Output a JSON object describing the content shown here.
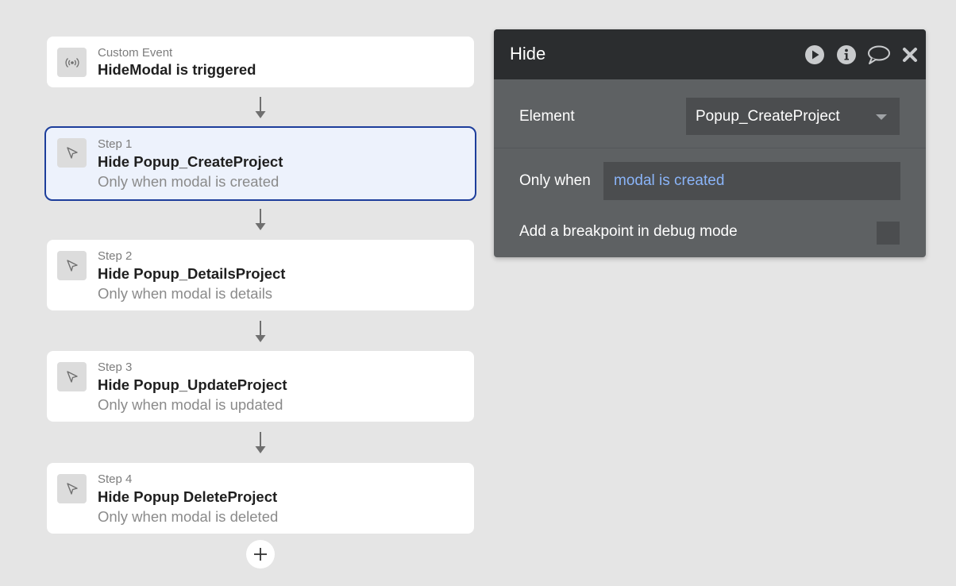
{
  "event": {
    "kind": "Custom Event",
    "title": "HideModal is triggered",
    "icon": "broadcast-icon"
  },
  "steps": [
    {
      "kind": "Step 1",
      "title": "Hide Popup_CreateProject",
      "condition": "Only when modal is created",
      "selected": true,
      "icon": "cursor-icon"
    },
    {
      "kind": "Step 2",
      "title": "Hide Popup_DetailsProject",
      "condition": "Only when modal is details",
      "selected": false,
      "icon": "cursor-icon"
    },
    {
      "kind": "Step 3",
      "title": "Hide Popup_UpdateProject",
      "condition": "Only when modal is updated",
      "selected": false,
      "icon": "cursor-icon"
    },
    {
      "kind": "Step 4",
      "title": "Hide Popup DeleteProject",
      "condition": "Only when modal is deleted",
      "selected": false,
      "icon": "cursor-icon"
    }
  ],
  "add_step_icon": "plus-icon",
  "panel": {
    "title": "Hide",
    "header_icons": [
      "play-icon",
      "info-icon",
      "comment-icon",
      "close-icon"
    ],
    "element_label": "Element",
    "element_value": "Popup_CreateProject",
    "only_when_label": "Only when",
    "only_when_value": "modal is created",
    "breakpoint_label": "Add a breakpoint in debug mode",
    "breakpoint_checked": false
  },
  "colors": {
    "background": "#e5e5e5",
    "selected_border": "#1d3e9b",
    "selected_fill": "#edf2fc",
    "panel_header": "#2b2d2f",
    "panel_body": "#5e6163",
    "expression_text": "#8ab4f8"
  }
}
